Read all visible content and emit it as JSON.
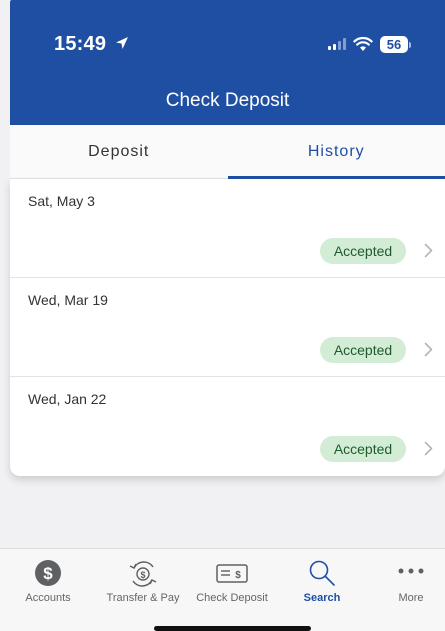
{
  "status_bar": {
    "time": "15:49",
    "battery": "56",
    "icons": [
      "location-arrow-icon",
      "signal-icon",
      "wifi-icon",
      "battery-icon"
    ]
  },
  "header": {
    "title": "Check Deposit"
  },
  "tabs": [
    {
      "label": "Deposit",
      "active": false
    },
    {
      "label": "History",
      "active": true
    }
  ],
  "history": [
    {
      "date": "Sat, May 3",
      "status": "Accepted"
    },
    {
      "date": "Wed, Mar 19",
      "status": "Accepted"
    },
    {
      "date": "Wed, Jan 22",
      "status": "Accepted"
    }
  ],
  "bottom_nav": [
    {
      "label": "Accounts",
      "icon": "dollar-circle-icon",
      "active": false
    },
    {
      "label": "Transfer & Pay",
      "icon": "transfer-icon",
      "active": false
    },
    {
      "label": "Check Deposit",
      "icon": "check-icon",
      "active": false
    },
    {
      "label": "Search",
      "icon": "search-icon",
      "active": true
    },
    {
      "label": "More",
      "icon": "more-icon",
      "active": false
    }
  ],
  "colors": {
    "brand": "#1f4fa3",
    "badge_bg": "#d3ecd6",
    "badge_text": "#1f5a2b"
  }
}
